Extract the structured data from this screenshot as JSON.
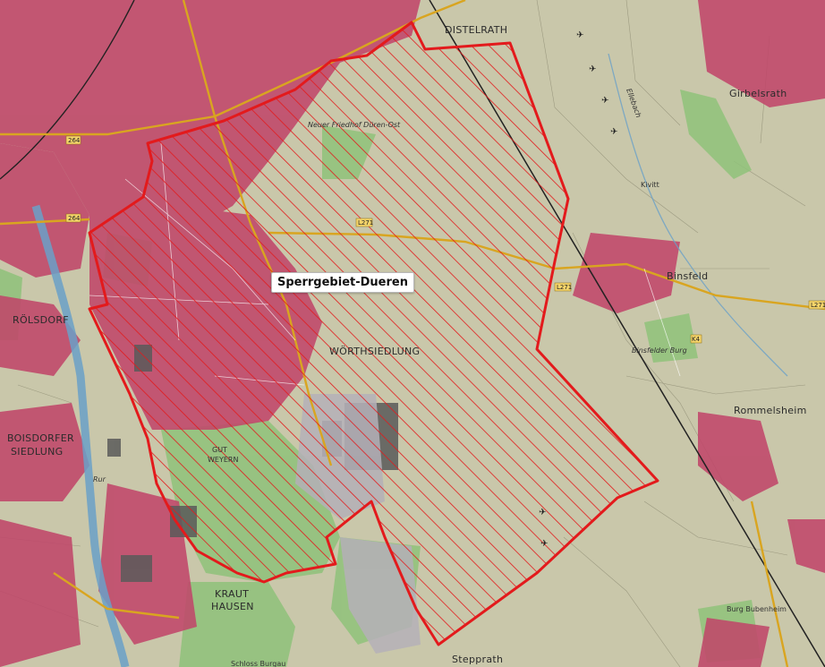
{
  "map": {
    "title_label": "Sperrgebiet-Dueren",
    "places": {
      "distelrath": "DISTELRATH",
      "girbelsrath": "Girbelsrath",
      "binsfeld": "Binsfeld",
      "rolsdorf": "RÖLSDORF",
      "boisdorfer_1": "BOISDORFER",
      "boisdorfer_2": "SIEDLUNG",
      "worthsiedlung": "WÖRTHSIEDLUNG",
      "rommelsheim": "Rommelsheim",
      "krauthausen_1": "KRAUT",
      "krauthausen_2": "HAUSEN",
      "stepprath": "Stepprath",
      "kivitt": "Kivitt",
      "gut_weyern_1": "GUT",
      "gut_weyern_2": "WEYERN",
      "neuer_friedhof": "Neuer Friedhof Düren-Ost",
      "binsfelder_burg": "Binsfelder Burg",
      "burg_bubenheim": "Burg Bubenheim",
      "schloss_burgau": "Schloss Burgau",
      "rur": "Rur",
      "ellebach": "Ellebach"
    },
    "roads": [
      "L271",
      "L271",
      "264",
      "264",
      "K4",
      "L271"
    ],
    "colors": {
      "restricted_zone": "#e31a1c",
      "built_up": "#c0476a",
      "farmland": "#c8c6a8",
      "forest": "#8fc27a",
      "water": "#6aa0c8",
      "main_road": "#d9a520"
    }
  }
}
